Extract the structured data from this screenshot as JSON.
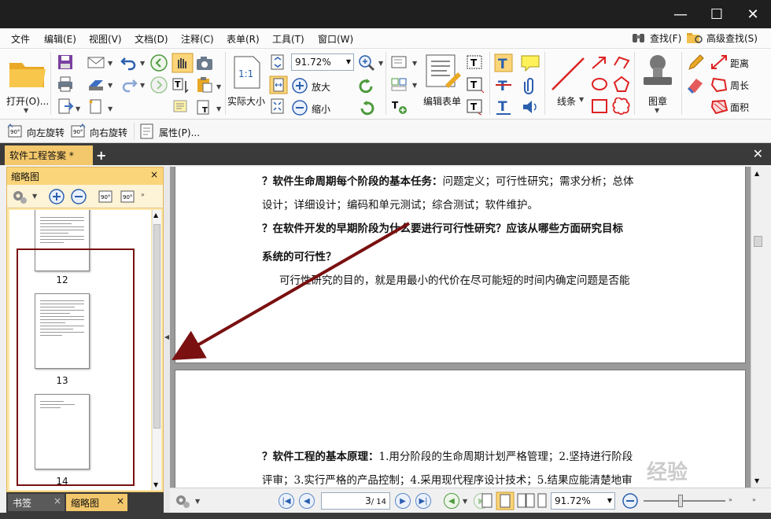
{
  "window": {
    "controls": {
      "minimize": "—",
      "maximize": "☐",
      "close": "✕"
    }
  },
  "menu": {
    "items": [
      "文件",
      "编辑(E)",
      "视图(V)",
      "文档(D)",
      "注释(C)",
      "表单(R)",
      "工具(T)",
      "窗口(W)"
    ],
    "find_label": "查找(F)",
    "advanced_find_label": "高级查找(S)"
  },
  "ribbon": {
    "open_label": "打开(O)...",
    "zoom_value": "91.72%",
    "actual_size_label": "实际大小",
    "zoom_in_label": "放大",
    "zoom_out_label": "缩小",
    "edit_form_label": "编辑表单",
    "line_label": "线条",
    "stamp_label": "图章",
    "distance_label": "距离",
    "perimeter_label": "周长",
    "area_label": "面积",
    "actual_size_glyph": "1:1"
  },
  "toolbar2": {
    "rotate_left_label": "向左旋转",
    "rotate_right_label": "向右旋转",
    "properties_label": "属性(P)..."
  },
  "tabs": {
    "document_tab": "软件工程答案 *",
    "add_tab": "+",
    "close_doc": "✕"
  },
  "left_panel": {
    "title": "缩略图",
    "close": "×",
    "thumbnails": [
      {
        "page": "12",
        "lines": 9
      },
      {
        "page": "13",
        "lines": 12
      },
      {
        "page": "14",
        "lines": 3
      }
    ],
    "bottom_tabs": [
      {
        "label": "书签",
        "active": false
      },
      {
        "label": "缩略图",
        "active": true
      }
    ]
  },
  "document": {
    "page1_lines": [
      {
        "bold": "？软件生命周期每个阶段的基本任务：",
        "text": "问题定义；可行性研究；需求分析；总体"
      },
      {
        "bold": "",
        "text": "设计；详细设计；编码和单元测试；综合测试；软件维护。"
      },
      {
        "bold": "？在软件开发的早期阶段为什么要进行可行性研究？应该从哪些方面研究目标",
        "text": ""
      },
      {
        "bold": "系统的可行性？",
        "text": ""
      },
      {
        "bold": "",
        "text": "可行性研究的目的，就是用最小的代价在尽可能短的时间内确定问题是否能"
      }
    ],
    "page2_lines": [
      {
        "bold": "？软件工程的基本原理：",
        "text": "1.用分阶段的生命周期计划严格管理；2.坚持进行阶段"
      },
      {
        "bold": "",
        "text": "评审；3.实行严格的产品控制；4.采用现代程序设计技术；5.结果应能清楚地审"
      }
    ]
  },
  "status": {
    "page_current": "3",
    "page_total": "/ 14",
    "zoom": "91.72%"
  },
  "watermark": "经验",
  "colors": {
    "accent_orange": "#f3c76b",
    "selection_border": "#7a1010",
    "arrow": "#7a1010",
    "dark_chrome": "#1f1f1f"
  }
}
